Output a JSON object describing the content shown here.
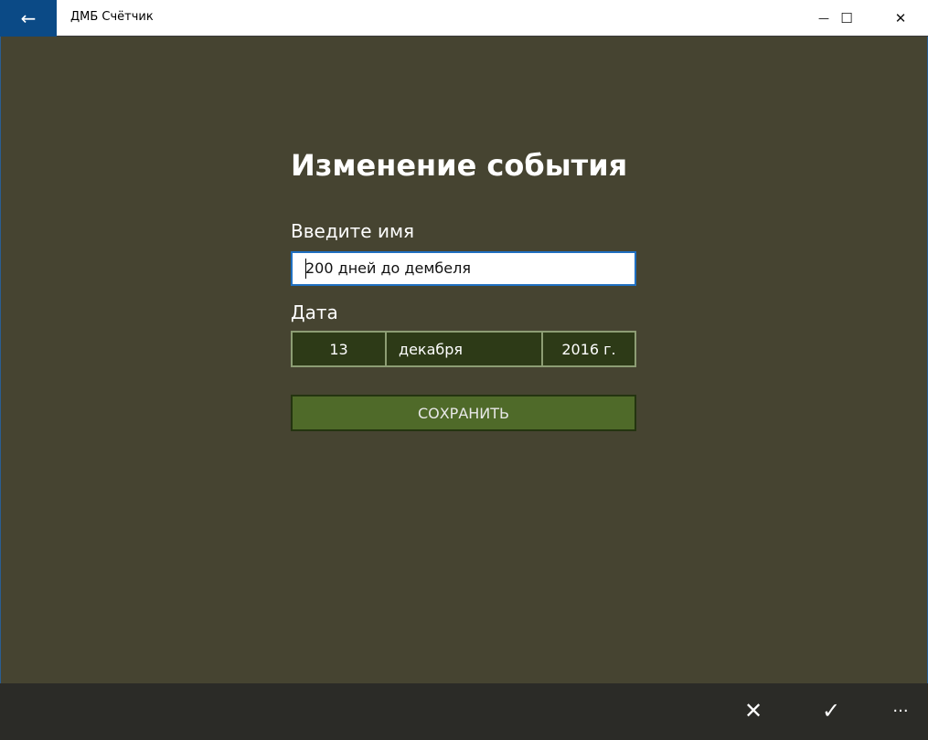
{
  "window": {
    "title": "ДМБ Счётчик",
    "back_icon": "←",
    "minimize_icon": "—",
    "maximize_icon": "☐",
    "close_icon": "✕"
  },
  "page": {
    "title": "Изменение события",
    "name_label": "Введите имя",
    "name_value": "200 дней до дембеля",
    "date_label": "Дата",
    "date": {
      "day": "13",
      "month": "декабря",
      "year": "2016 г."
    },
    "save_label": "СОХРАНИТЬ"
  },
  "appbar": {
    "cancel_icon": "✕",
    "accept_icon": "✓",
    "more_icon": "···"
  }
}
